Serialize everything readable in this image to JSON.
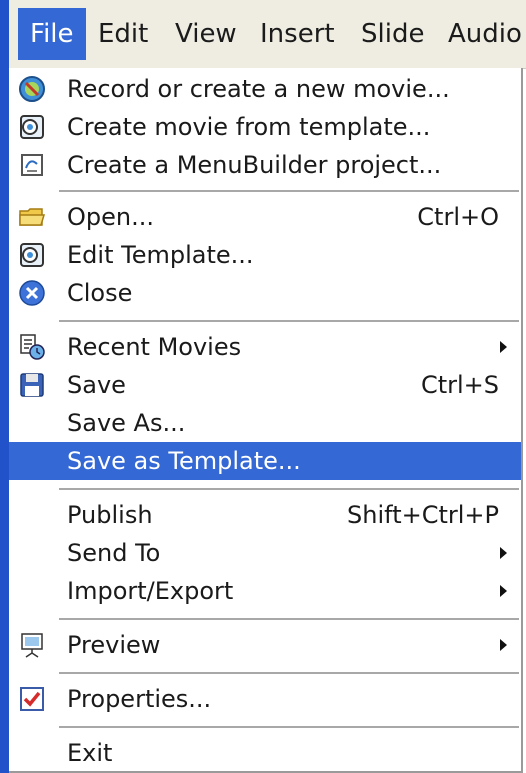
{
  "menubar": {
    "items": [
      {
        "label": "File",
        "active": true
      },
      {
        "label": "Edit"
      },
      {
        "label": "View"
      },
      {
        "label": "Insert"
      },
      {
        "label": "Slide"
      },
      {
        "label": "Audio"
      }
    ]
  },
  "menu": {
    "record": {
      "label": "Record or create a new movie...",
      "icon": "record-movie-icon"
    },
    "from_template": {
      "label": "Create movie from template...",
      "icon": "template-movie-icon"
    },
    "menubuilder": {
      "label": "Create a MenuBuilder project...",
      "icon": "menubuilder-icon"
    },
    "open": {
      "label": "Open...",
      "shortcut": "Ctrl+O",
      "icon": "folder-icon"
    },
    "edit_template": {
      "label": "Edit Template...",
      "icon": "template-edit-icon"
    },
    "close": {
      "label": "Close",
      "icon": "close-icon"
    },
    "recent": {
      "label": "Recent Movies",
      "icon": "recent-movies-icon"
    },
    "save": {
      "label": "Save",
      "shortcut": "Ctrl+S",
      "icon": "floppy-disk-icon"
    },
    "save_as": {
      "label": "Save As..."
    },
    "save_as_template": {
      "label": "Save as Template...",
      "highlighted": true
    },
    "publish": {
      "label": "Publish",
      "shortcut": "Shift+Ctrl+P"
    },
    "send_to": {
      "label": "Send To"
    },
    "import_export": {
      "label": "Import/Export"
    },
    "preview": {
      "label": "Preview",
      "icon": "preview-presentation-icon"
    },
    "properties": {
      "label": "Properties...",
      "icon": "checkbox-checked-icon"
    },
    "exit": {
      "label": "Exit"
    }
  },
  "colors": {
    "highlight": "#3468d4",
    "menubar_bg": "#efede2",
    "left_stripe": "#2152c9"
  }
}
